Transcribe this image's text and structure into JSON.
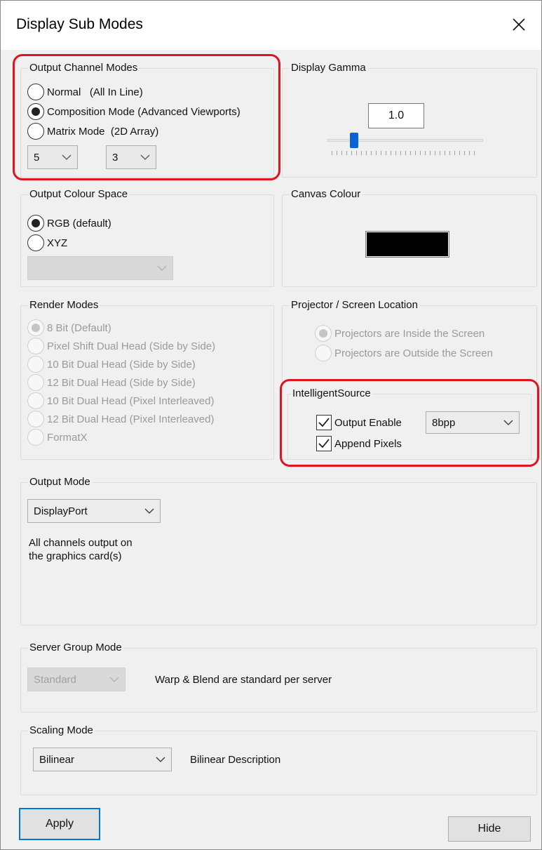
{
  "window": {
    "title": "Display Sub Modes"
  },
  "output_channel_modes": {
    "label": "Output Channel Modes",
    "options": [
      {
        "label": "Normal   (All In Line)",
        "checked": false
      },
      {
        "label": "Composition Mode (Advanced Viewports)",
        "checked": true
      },
      {
        "label": "Matrix Mode  (2D Array)",
        "checked": false
      }
    ],
    "dropdown1_value": "5",
    "dropdown2_value": "3"
  },
  "display_gamma": {
    "label": "Display Gamma",
    "value": "1.0",
    "slider_level": 0.15
  },
  "output_colour_space": {
    "label": "Output Colour Space",
    "options": [
      {
        "label": "RGB (default)",
        "checked": true
      },
      {
        "label": "XYZ",
        "checked": false
      }
    ],
    "dropdown_value": ""
  },
  "canvas_colour": {
    "label": "Canvas Colour",
    "color": "#000000"
  },
  "render_modes": {
    "label": "Render Modes",
    "options": [
      {
        "label": "8 Bit (Default)",
        "checked": true
      },
      {
        "label": "Pixel Shift Dual Head (Side by Side)",
        "checked": false
      },
      {
        "label": "10 Bit Dual Head (Side by Side)",
        "checked": false
      },
      {
        "label": "12 Bit Dual Head (Side by Side)",
        "checked": false
      },
      {
        "label": "10 Bit Dual Head (Pixel Interleaved)",
        "checked": false
      },
      {
        "label": "12 Bit Dual Head (Pixel Interleaved)",
        "checked": false
      },
      {
        "label": "FormatX",
        "checked": false
      }
    ]
  },
  "projector_location": {
    "label": "Projector / Screen Location",
    "options": [
      {
        "label": "Projectors are Inside the Screen",
        "checked": true
      },
      {
        "label": "Projectors are Outside the Screen",
        "checked": false
      }
    ]
  },
  "intelligent_source": {
    "label": "IntelligentSource",
    "output_enable_label": "Output Enable",
    "output_enable_checked": true,
    "bpp_value": "8bpp",
    "append_pixels_label": "Append Pixels",
    "append_pixels_checked": true
  },
  "output_mode": {
    "label": "Output Mode",
    "dropdown_value": "DisplayPort",
    "description_line1": "All channels output on",
    "description_line2": "the graphics card(s)"
  },
  "server_group_mode": {
    "label": "Server Group Mode",
    "dropdown_value": "Standard",
    "description": "Warp & Blend are standard per server"
  },
  "scaling_mode": {
    "label": "Scaling Mode",
    "dropdown_value": "Bilinear",
    "description": "Bilinear Description"
  },
  "buttons": {
    "apply": "Apply",
    "hide": "Hide"
  },
  "colors": {
    "highlight": "#e0141e",
    "default_button_border": "#0078d7"
  }
}
